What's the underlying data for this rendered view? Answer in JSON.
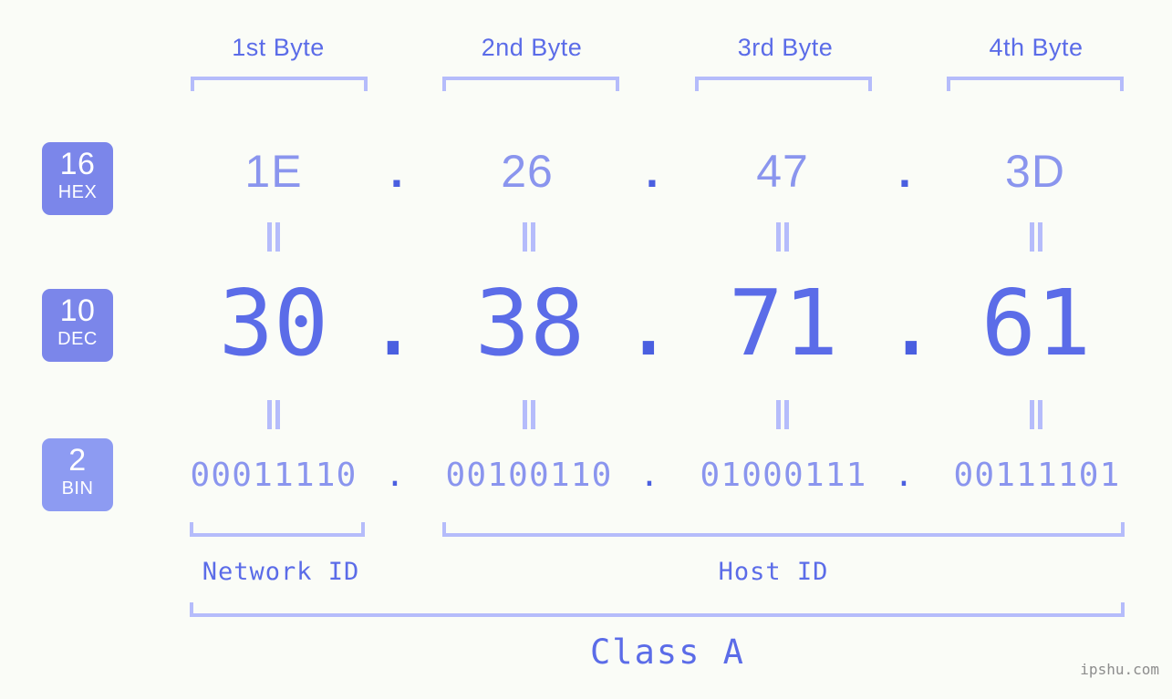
{
  "colors": {
    "background": "#fafcf7",
    "accent_strong": "#4a5fe0",
    "accent": "#5b6ce8",
    "accent_light": "#8a95ee",
    "bracket": "#b5bcfb",
    "badge_dark": "#7b86ea",
    "badge_light": "#8d9bf2",
    "watermark": "#8d8d8d"
  },
  "byte_headers": [
    {
      "label": "1st Byte"
    },
    {
      "label": "2nd Byte"
    },
    {
      "label": "3rd Byte"
    },
    {
      "label": "4th Byte"
    }
  ],
  "radix_badges": [
    {
      "number": "16",
      "name": "HEX"
    },
    {
      "number": "10",
      "name": "DEC"
    },
    {
      "number": "2",
      "name": "BIN"
    }
  ],
  "separator": ".",
  "equals_sign": "=",
  "rows": {
    "hex": {
      "radix_number": "16",
      "radix_name": "HEX",
      "octets": [
        "1E",
        "26",
        "47",
        "3D"
      ]
    },
    "dec": {
      "radix_number": "10",
      "radix_name": "DEC",
      "octets": [
        "30",
        "38",
        "71",
        "61"
      ]
    },
    "bin": {
      "radix_number": "2",
      "radix_name": "BIN",
      "octets": [
        "00011110",
        "00100110",
        "01000111",
        "00111101"
      ]
    }
  },
  "partition": {
    "network_id_label": "Network ID",
    "host_id_label": "Host ID",
    "class_label": "Class A"
  },
  "watermark": "ipshu.com"
}
